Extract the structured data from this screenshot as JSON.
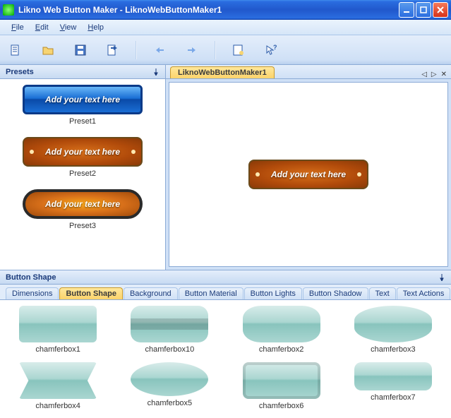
{
  "window": {
    "title": "Likno Web Button Maker - LiknoWebButtonMaker1"
  },
  "menu": {
    "file": "File",
    "edit": "Edit",
    "view": "View",
    "help": "Help"
  },
  "presets": {
    "header": "Presets",
    "items": [
      {
        "label": "Preset1",
        "text": "Add your text here"
      },
      {
        "label": "Preset2",
        "text": "Add your text here"
      },
      {
        "label": "Preset3",
        "text": "Add your text here"
      }
    ]
  },
  "doc": {
    "tab": "LiknoWebButtonMaker1",
    "button_text": "Add your text here"
  },
  "shapePanel": {
    "header": "Button Shape",
    "tabs": [
      "Dimensions",
      "Button Shape",
      "Background",
      "Button Material",
      "Button Lights",
      "Button Shadow",
      "Text",
      "Text Actions"
    ],
    "shapes": [
      "chamferbox1",
      "chamferbox10",
      "chamferbox2",
      "chamferbox3",
      "chamferbox4",
      "chamferbox5",
      "chamferbox6",
      "chamferbox7"
    ]
  }
}
